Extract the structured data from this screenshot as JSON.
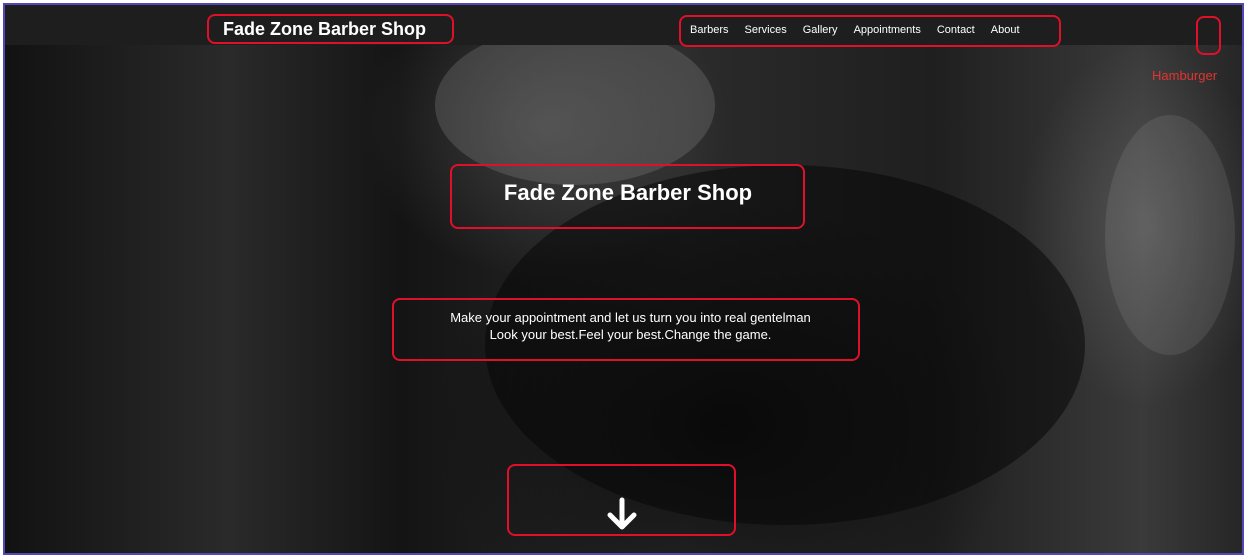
{
  "navbar": {
    "brand": "Fade Zone Barber Shop",
    "links": [
      "Barbers",
      "Services",
      "Gallery",
      "Appointments",
      "Contact",
      "About"
    ]
  },
  "hero": {
    "title": "Fade Zone Barber Shop",
    "tagline_line1": "Make your appointment and let us turn you into real gentelman",
    "tagline_line2": "Look your best.Feel your best.Change the game.",
    "scroll_icon": "arrow-down-icon"
  },
  "annotations": {
    "hamburger_label": "Hamburger",
    "color": "#e0102a"
  }
}
